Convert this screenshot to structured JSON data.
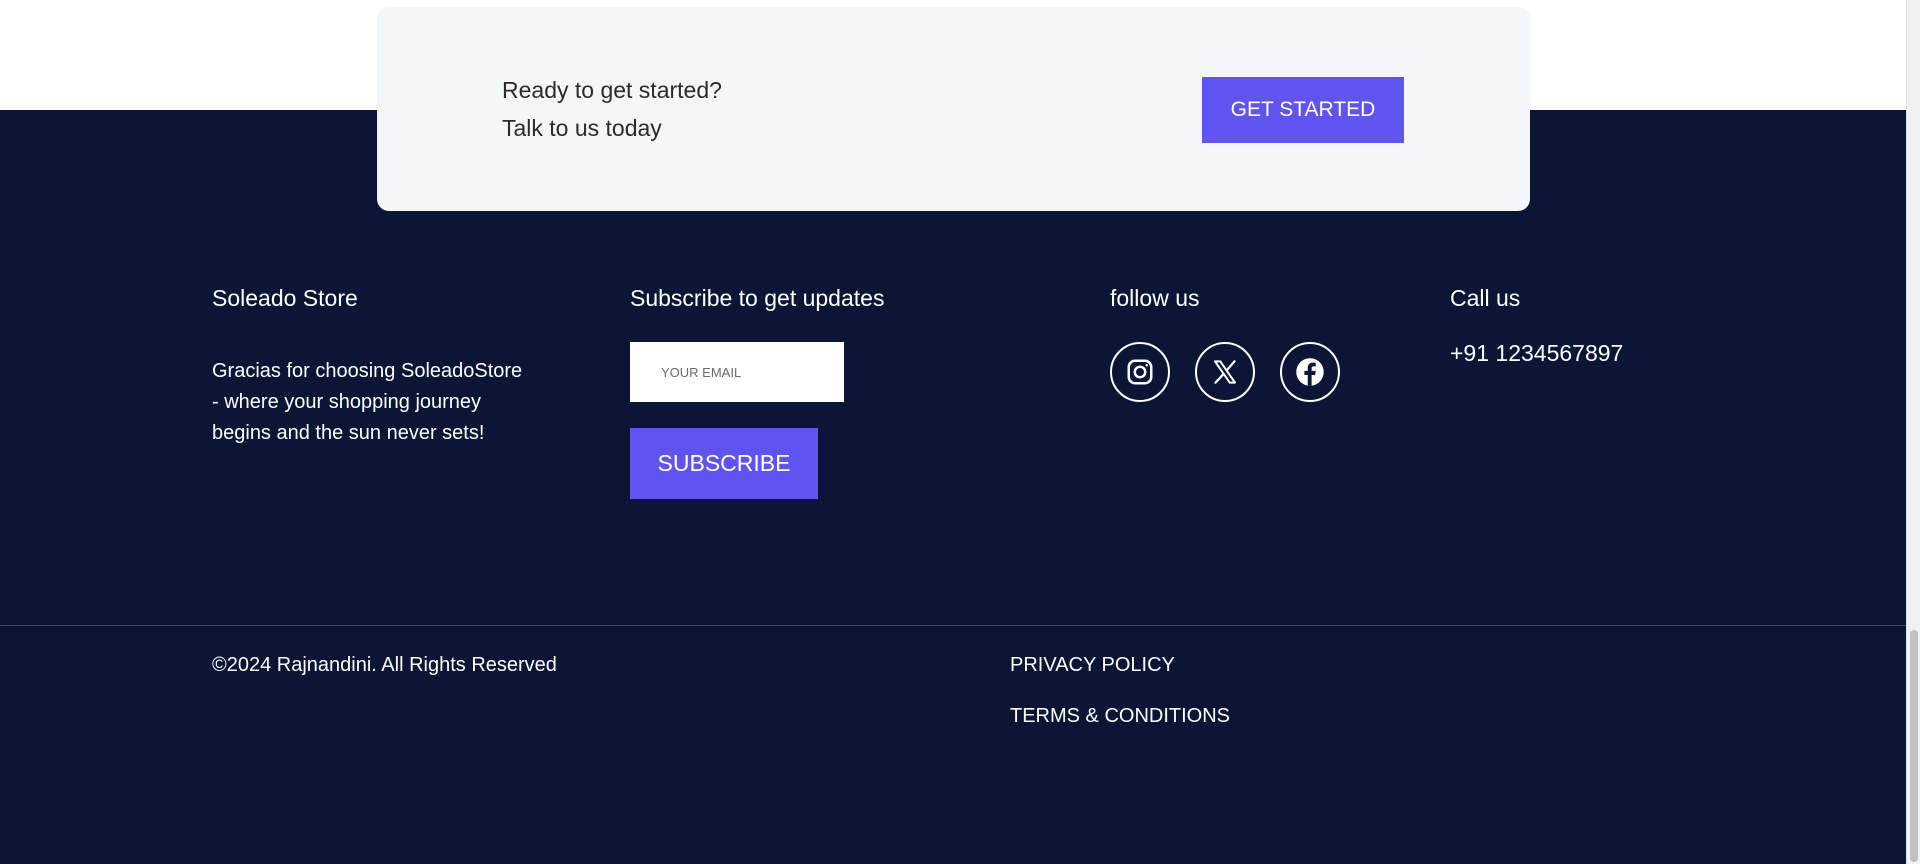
{
  "cta": {
    "line1": "Ready to get started?",
    "line2": "Talk to us today",
    "button_label": "GET STARTED"
  },
  "footer": {
    "brand": {
      "title": "Soleado Store",
      "description": "Gracias for choosing SoleadoStore - where your shopping journey begins and the sun never sets!"
    },
    "subscribe": {
      "title": "Subscribe to get updates",
      "email_placeholder": "YOUR EMAIL",
      "email_value": "",
      "button_label": "SUBSCRIBE"
    },
    "follow": {
      "title": "follow us",
      "icons": [
        "instagram-icon",
        "x-twitter-icon",
        "facebook-icon"
      ]
    },
    "call": {
      "title": "Call us",
      "phone": "+91 1234567897"
    },
    "copyright": "©2024 Rajnandini. All Rights Reserved",
    "links": {
      "privacy": "PRIVACY POLICY",
      "terms": "TERMS & CONDITIONS"
    }
  },
  "colors": {
    "footer_bg": "#0b1535",
    "accent": "#6054f0",
    "card_bg": "#f5f6f9"
  }
}
